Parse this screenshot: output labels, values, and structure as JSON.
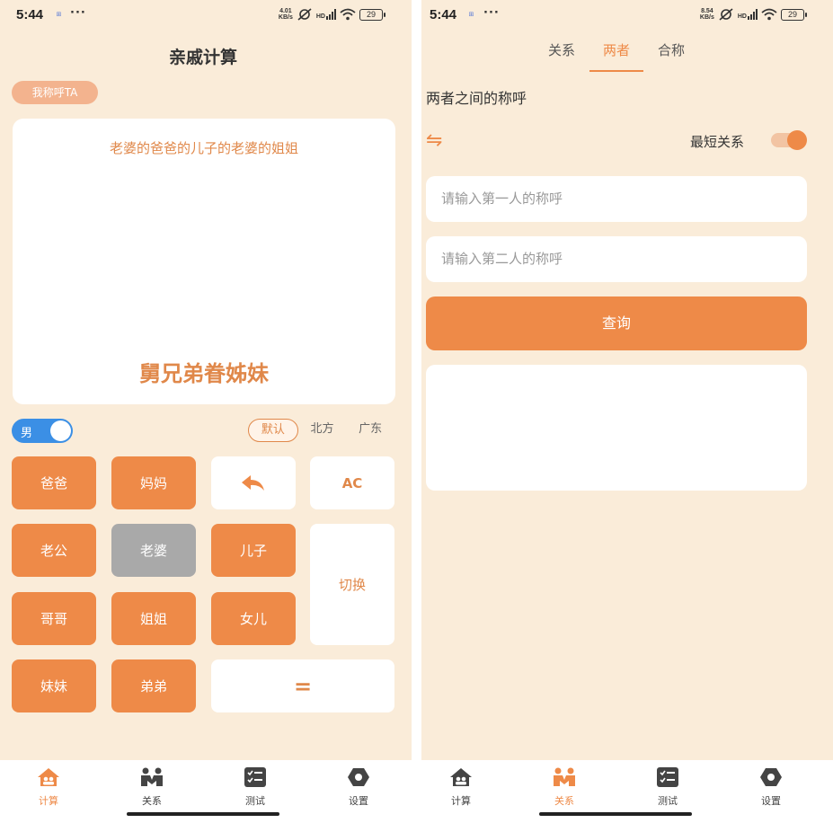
{
  "status": {
    "time": "5:44",
    "dots": "···",
    "left_speed": [
      "4.01",
      "KB/s"
    ],
    "right_speed": [
      "8.54",
      "KB/s"
    ],
    "hd": "HD",
    "battery": "29"
  },
  "calc": {
    "title": "亲戚计算",
    "call_ta_pill": "我称呼TA",
    "expression": "老婆的爸爸的儿子的老婆的姐姐",
    "result": "舅兄弟眷姊妹",
    "sex_label": "男",
    "dialects": [
      "默认",
      "北方",
      "广东"
    ],
    "keys": {
      "father": "爸爸",
      "mother": "妈妈",
      "ac": "AC",
      "husband": "老公",
      "wife": "老婆",
      "son": "儿子",
      "switch": "切换",
      "elder_brother": "哥哥",
      "elder_sister": "姐姐",
      "daughter": "女儿",
      "younger_sister": "妹妹",
      "younger_brother": "弟弟",
      "equals": "="
    }
  },
  "relation": {
    "tabs": [
      "关系",
      "两者",
      "合称"
    ],
    "active_tab": "两者",
    "subtitle": "两者之间的称呼",
    "swap_icon": "⇋",
    "shortest_label": "最短关系",
    "first_placeholder": "请输入第一人的称呼",
    "second_placeholder": "请输入第二人的称呼",
    "query_label": "查询"
  },
  "nav": {
    "items": [
      "计算",
      "关系",
      "测试",
      "设置"
    ]
  },
  "colors": {
    "accent": "#ee8a48",
    "background": "#faecd9",
    "pill": "#f3b38e",
    "switch_blue": "#3b8fe5",
    "disabled_key": "#a9a9a9"
  }
}
